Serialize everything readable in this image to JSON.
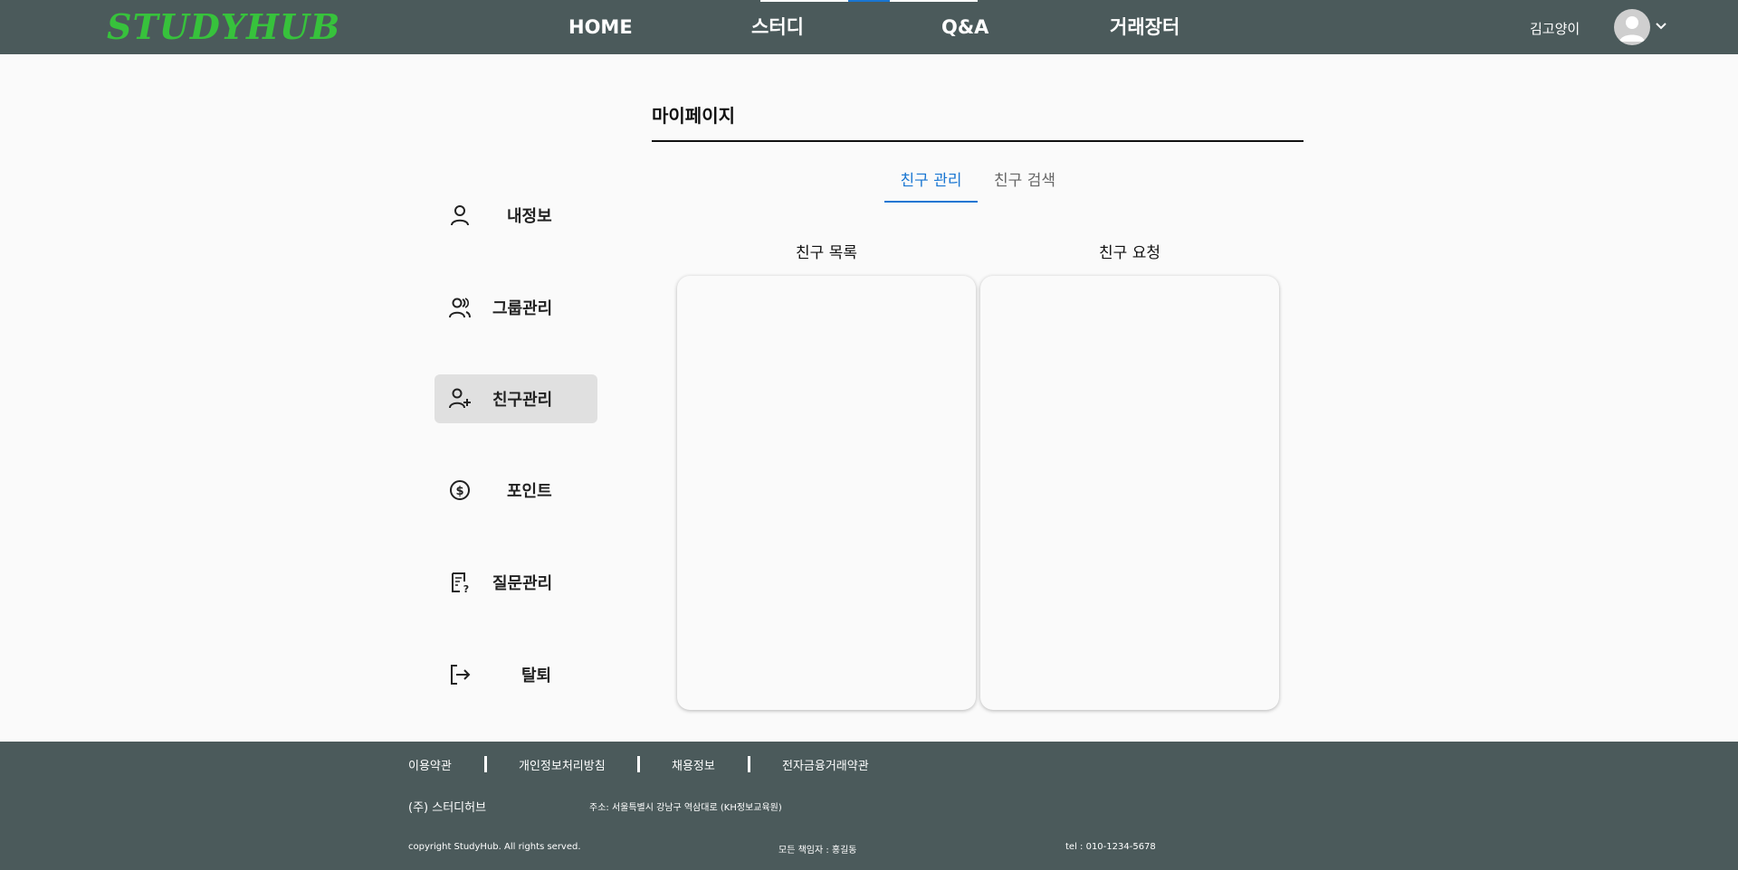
{
  "header": {
    "logo_main": "STUDY",
    "logo_end": "HUB",
    "nav": [
      "HOME",
      "스터디",
      "Q&A",
      "거래장터"
    ],
    "username": "김고양이",
    "colors": {
      "bar": "#4b5a5b",
      "logo_green": "#37c23c",
      "logo_brown": "#b08d57"
    }
  },
  "page": {
    "title": "마이페이지"
  },
  "sidebar": {
    "items": [
      {
        "label": "내정보",
        "icon": "user-icon"
      },
      {
        "label": "그룹관리",
        "icon": "users-icon"
      },
      {
        "label": "친구관리",
        "icon": "user-plus-icon",
        "active": true
      },
      {
        "label": "포인트",
        "icon": "coin-icon"
      },
      {
        "label": "질문관리",
        "icon": "question-doc-icon"
      },
      {
        "label": "탈퇴",
        "icon": "logout-icon"
      }
    ]
  },
  "tabs": [
    {
      "label": "친구 관리",
      "active": true
    },
    {
      "label": "친구 검색",
      "active": false
    }
  ],
  "friends": {
    "list_title": "친구 목록",
    "request_title": "친구 요청"
  },
  "footer": {
    "links": [
      "이용약관",
      "개인정보처리방침",
      "채용정보",
      "전자금융거래약관"
    ],
    "company": "(주) 스터디허브",
    "address": "주소: 서울특별시 강남구 역삼대로 (KH정보교육원)",
    "copyright": "copyright StudyHub. All rights served.",
    "manager": "모든 책임자 : 홍길동",
    "tel": "tel : 010-1234-5678"
  }
}
